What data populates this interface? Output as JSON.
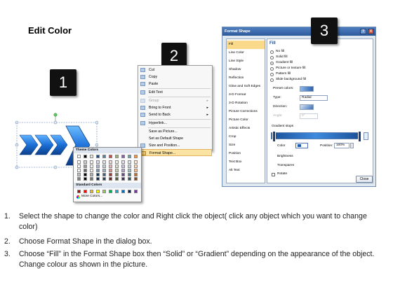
{
  "title": "Edit Color",
  "badges": [
    "1",
    "2",
    "3"
  ],
  "context_menu": {
    "items": [
      {
        "label": "Cut",
        "underline": "t",
        "icon": "scissors-icon",
        "arrow": false,
        "disabled": false
      },
      {
        "label": "Copy",
        "icon": "copy-icon",
        "arrow": false,
        "disabled": false
      },
      {
        "label": "Paste",
        "icon": "paste-icon",
        "arrow": false,
        "disabled": false
      },
      {
        "label": "Edit Text",
        "icon": "text-icon",
        "arrow": false,
        "disabled": false
      },
      {
        "label": "Group",
        "icon": "group-icon",
        "arrow": true,
        "disabled": true
      },
      {
        "label": "Bring to Front",
        "icon": "bring-front-icon",
        "arrow": true,
        "disabled": false
      },
      {
        "label": "Send to Back",
        "icon": "send-back-icon",
        "arrow": true,
        "disabled": false
      },
      {
        "label": "Hyperlink...",
        "icon": "hyperlink-icon",
        "arrow": false,
        "disabled": false
      },
      {
        "label": "Save as Picture...",
        "icon": "",
        "arrow": false,
        "disabled": false
      },
      {
        "label": "Set as Default Shape",
        "icon": "",
        "arrow": false,
        "disabled": false
      },
      {
        "label": "Size and Position...",
        "icon": "size-icon",
        "arrow": false,
        "disabled": false
      },
      {
        "label": "Format Shape...",
        "icon": "format-shape-icon",
        "arrow": false,
        "disabled": false,
        "highlighted": true
      }
    ]
  },
  "dialog": {
    "title": "Format Shape",
    "help": "?",
    "close_x": "X",
    "categories": [
      "Fill",
      "Line Color",
      "Line Style",
      "Shadow",
      "Reflection",
      "Glow and Soft Edges",
      "3-D Format",
      "3-D Rotation",
      "Picture Corrections",
      "Picture Color",
      "Artistic Effects",
      "Crop",
      "Size",
      "Position",
      "Text Box",
      "Alt Text"
    ],
    "selected_category": "Fill",
    "fill_heading": "Fill",
    "fill_options": [
      "No fill",
      "Solid fill",
      "Gradient fill",
      "Picture or texture fill",
      "Pattern fill",
      "Slide background fill"
    ],
    "selected_fill": "Gradient fill",
    "preset_colors_label": "Preset colors:",
    "type_label": "Type:",
    "type_value": "Radial",
    "direction_label": "Direction:",
    "angle_label": "Angle:",
    "angle_value": "0°",
    "gradient_stops_label": "Gradient stops",
    "color_label": "Color",
    "position_label": "Position:",
    "position_value": "100%",
    "brightness_label": "Brightness",
    "transparency_label": "Transparen",
    "rotate_label": "Rotate",
    "close_button": "Close",
    "palette": {
      "theme_colors_label": "Theme Colors",
      "standard_colors_label": "Standard Colors",
      "more_colors_label": "More Colors...",
      "theme_top_row": [
        "#ffffff",
        "#000000",
        "#eeece1",
        "#1f497d",
        "#4f81bd",
        "#c0504d",
        "#9bbb59",
        "#8064a2",
        "#4bacc6",
        "#f79646"
      ],
      "standard_colors": [
        "#c00000",
        "#ff0000",
        "#ffc000",
        "#ffff00",
        "#92d050",
        "#00b050",
        "#00b0f0",
        "#0070c0",
        "#002060",
        "#7030a0"
      ]
    }
  },
  "instructions": [
    {
      "num": "1.",
      "text": "Select the shape to change the color and Right click the object( click any object which you want to change color)"
    },
    {
      "num": "2.",
      "text": "Choose Format Shape in the dialog box."
    },
    {
      "num": "3.",
      "text": "Choose “Fill” in the Format Shape box then “Solid” or “Gradient” depending on the appearance of the object. Change colour as shown in the picture."
    }
  ]
}
